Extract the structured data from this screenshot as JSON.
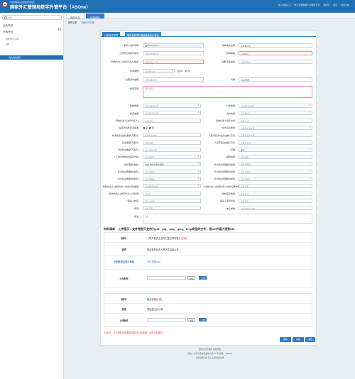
{
  "header": {
    "subtitle": "中国(福建)自由贸易试验区",
    "title": "国家外汇管理局数字外管平台（ASOne）",
    "right_items": [
      "进入外网入口",
      "外汇管理数据平台服务平台",
      "欢迎您",
      "首页",
      "退出系统"
    ]
  },
  "sidebar": {
    "search_placeholder": "搜索",
    "items": [
      {
        "label": "企业机关",
        "level": 1
      },
      {
        "label": "行政许可",
        "level": 1
      },
      {
        "label": "境外外汇公司",
        "level": 2
      },
      {
        "label": "ODI",
        "level": 2
      }
    ],
    "active_item": "境内机构登记",
    "collapse_symbol": "−"
  },
  "tabs": [
    "我的业务",
    "行政许可"
  ],
  "breadcrumb": {
    "home": "我的业务",
    "current": "行政许可办理"
  },
  "panel_tabs": [
    "行政许可事项",
    "境内机构境外直接投资外汇登记"
  ],
  "form": {
    "fields": [
      {
        "label": "申请人证件号码",
        "req": true,
        "value": "91****************",
        "filled": true
      },
      {
        "label": "机构中文名称",
        "req": true,
        "value": "某有限公司",
        "val": true
      },
      {
        "label": "工商登记机构代码号",
        "req": false,
        "placeholder": "请填写机构代码"
      },
      {
        "label": "机构编码",
        "req": true,
        "placeholder": "机构编码",
        "err": true
      },
      {
        "label": "机构负责人(法定代表人)姓名",
        "req": true,
        "placeholder": "机构负责人姓名",
        "err": true
      },
      {
        "label": "注册/营业地址",
        "req": false,
        "placeholder": "请填写地址"
      },
      {
        "label": "投资期限",
        "req": false,
        "placeholder": "请选择日期"
      },
      {
        "label": "注册资本金额",
        "req": true,
        "placeholder": "注册资本金额"
      },
      {
        "label": "币种",
        "req": false,
        "value": "XXX 外币"
      },
      {
        "label": "经营范围",
        "req": true,
        "placeholder": "经营范围"
      }
    ],
    "radios": [
      "有",
      "无"
    ],
    "fields2": [
      {
        "label": "机构类型",
        "req": true,
        "placeholder": "请选择机构类型"
      },
      {
        "label": "行业类型",
        "req": true,
        "placeholder": "请选择行业类型"
      },
      {
        "label": "经济类型",
        "req": true,
        "placeholder": "请选择经济类型"
      },
      {
        "label": "境内地区",
        "req": false,
        "placeholder": "请选择地区"
      },
      {
        "label": "机构负责人(法定代表人)",
        "req": false,
        "placeholder": "机构负责人"
      },
      {
        "label": "机构负责人联系方式",
        "req": false,
        "placeholder": "联系方式"
      },
      {
        "label": "是否为境外投资企业",
        "req": true,
        "options": [
          "是",
          "否"
        ]
      },
      {
        "label": "境外投资类型",
        "req": true,
        "placeholder": "请选择投资类型"
      },
      {
        "label": "外方投资(出资)金额(万美元)",
        "req": false,
        "placeholder": "外方投资金额"
      },
      {
        "label": "人民币投资(出资)金额(万元)",
        "req": false,
        "placeholder": "人民币投资金额"
      },
      {
        "label": "投资金额(万美元)",
        "req": false,
        "placeholder": "投资金额"
      },
      {
        "label": "人民币投资金额(万元)",
        "req": false,
        "placeholder": "人民币金额"
      },
      {
        "label": "中方投资金额(万美元)",
        "req": false,
        "placeholder": "中方投资金额"
      },
      {
        "label": "币种",
        "req": true,
        "value": "美元"
      },
      {
        "label": "工商注册地址(区县)代码",
        "req": true,
        "placeholder": "请选择区县"
      },
      {
        "label": "邮政编码",
        "req": false,
        "placeholder": "邮政编码"
      },
      {
        "label": "境外国家(地区)",
        "req": true,
        "value": "CHN 中华人民共和国"
      },
      {
        "label": "外方投资者国别(地区)",
        "req": true,
        "placeholder": "请选择国别"
      },
      {
        "label": "外方投资者国别(地区)",
        "req": false,
        "placeholder": "请选择国别"
      },
      {
        "label": "外方投资者国别(地区)",
        "req": false,
        "placeholder": "请选择国别"
      },
      {
        "label": "外方投资者国别(地区)",
        "req": false,
        "placeholder": "请选择国别"
      },
      {
        "label": "外方投资者国别(地区)",
        "req": false,
        "placeholder": "请选择国别"
      },
      {
        "label": "机构负责人(法定代表人)身份证件类型",
        "req": true,
        "placeholder": "请选择证件类型"
      },
      {
        "label": "机构负责人(法定代表人)身份证件号码",
        "req": true,
        "placeholder": "证件号码"
      },
      {
        "label": "机构负责人(法定代表人)手机号",
        "req": true,
        "placeholder": "手机号"
      },
      {
        "label": "机构联系电话",
        "req": true,
        "placeholder": "联系电话"
      },
      {
        "label": "联系人姓名",
        "req": true,
        "placeholder": "联系人姓名"
      },
      {
        "label": "联系人手机号码",
        "req": true,
        "placeholder": "手机号码"
      },
      {
        "label": "传真",
        "req": false,
        "placeholder": "传真号码"
      },
      {
        "label": "电子邮箱",
        "req": false,
        "placeholder": "XXX@XXX.XXX"
      },
      {
        "label": "备注",
        "req": false,
        "placeholder": "备注"
      }
    ]
  },
  "materials": {
    "heading": "材料清单",
    "note": "上传提示：文件限制只支持为pdf、jpg、png、jpeg、bmp类型的文件，限pdf外最大限制2M",
    "items": [
      {
        "no": "材料1",
        "name": "《境外投资企业外汇登记申请表》",
        "tag": "[必填]",
        "desc_label": "说明",
        "desc": "须由机构负责人签字并加盖公章。",
        "sample_label": "示例样表及空白表格",
        "sample_link": "空白表格.doc",
        "upload_label": "上传附件"
      },
      {
        "no": "材料2",
        "name": "营业执照",
        "tag": "[必填]",
        "desc_label": "说明",
        "desc": "须加盖企业公章。",
        "upload_label": "上传附件"
      }
    ],
    "browse_label": "浏览",
    "upload_btn": "上传"
  },
  "warning": "※ 提示：以上材料请按要求填报并上传完整，请核对后提交。",
  "actions": [
    "保存",
    "暂存",
    "返回",
    "提交"
  ],
  "footer": {
    "line1": "国家外汇管理局  版权所有",
    "line2": "地址：北京市西城区金融大街 15 号  邮编：100033",
    "line3": "建议使用 IE8 及以上版本浏览器"
  }
}
